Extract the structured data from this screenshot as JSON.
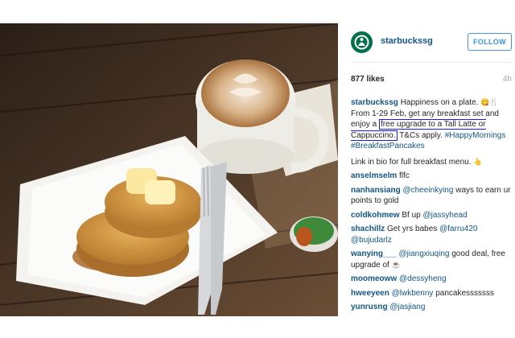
{
  "post": {
    "username": "starbuckssg",
    "follow_label": "FOLLOW",
    "likes": "877 likes",
    "age": "4h",
    "caption": {
      "username": "starbuckssg",
      "line1": "Happiness on a plate.",
      "emoji1": "😋🍴",
      "line2": "From 1-29 Feb, get any breakfast set and enjoy a",
      "highlight": "free upgrade to a Tall Latte or Cappuccino.",
      "line3": "T&Cs apply.",
      "hashtag1": "#HappyMornings",
      "hashtag2": "#BreakfastPancakes"
    },
    "bio_link_text": "Link in bio for full breakfast menu.",
    "bio_emoji": "👆"
  },
  "comments": [
    {
      "user": "anselmselm",
      "text": "flfc"
    },
    {
      "user": "nanhansiang",
      "mention": "@cheeinkying",
      "text": "ways to earn ur points to gold"
    },
    {
      "user": "coldkohmew",
      "text": "Bf up",
      "mention": "@jassyhead"
    },
    {
      "user": "shachillz",
      "text": "Get yrs babes",
      "mention": "@farru420",
      "mention2": "@bujudarlz"
    },
    {
      "user": "wanying___",
      "mention": "@jiangxiuqing",
      "text": "good deal, free upgrade of",
      "emoji": "☕"
    },
    {
      "user": "moomeoww",
      "mention": "@dessyheng"
    },
    {
      "user": "hweeyeen",
      "mention": "@lwkbenny",
      "text": "pancakesssssss"
    },
    {
      "user": "yunrusng",
      "mention": "@jasjiang"
    }
  ]
}
